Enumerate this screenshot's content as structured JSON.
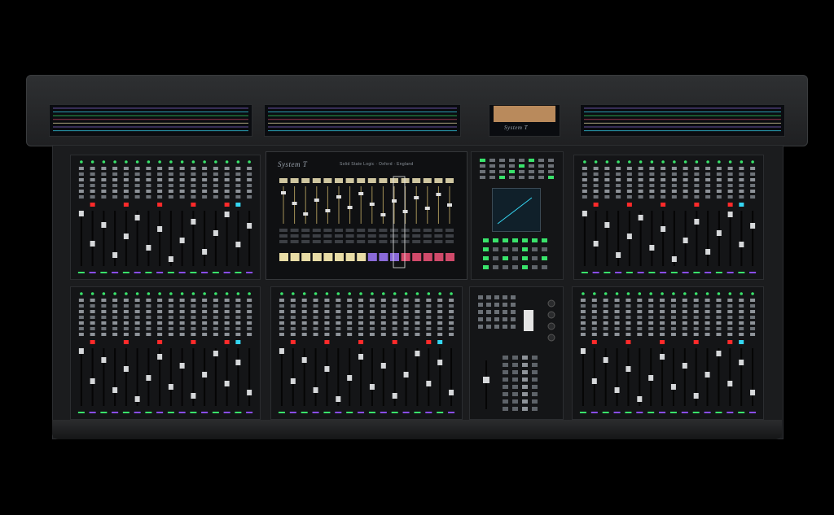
{
  "console": {
    "brand_title": "System T",
    "screen_title": "System T",
    "screen_subtitle": "Solid State Logic  ·  Oxford  ·  England"
  },
  "colors": {
    "background": "#000000",
    "chassis": "#232426",
    "panel": "#141517",
    "led_green": "#39e36b",
    "led_red": "#ff2a2a",
    "led_cyan": "#35d6f2",
    "led_purple": "#8a4dff",
    "screen_cream": "#e8dca5",
    "screen_purple": "#8a6ad8",
    "screen_pink": "#d04a6a"
  }
}
